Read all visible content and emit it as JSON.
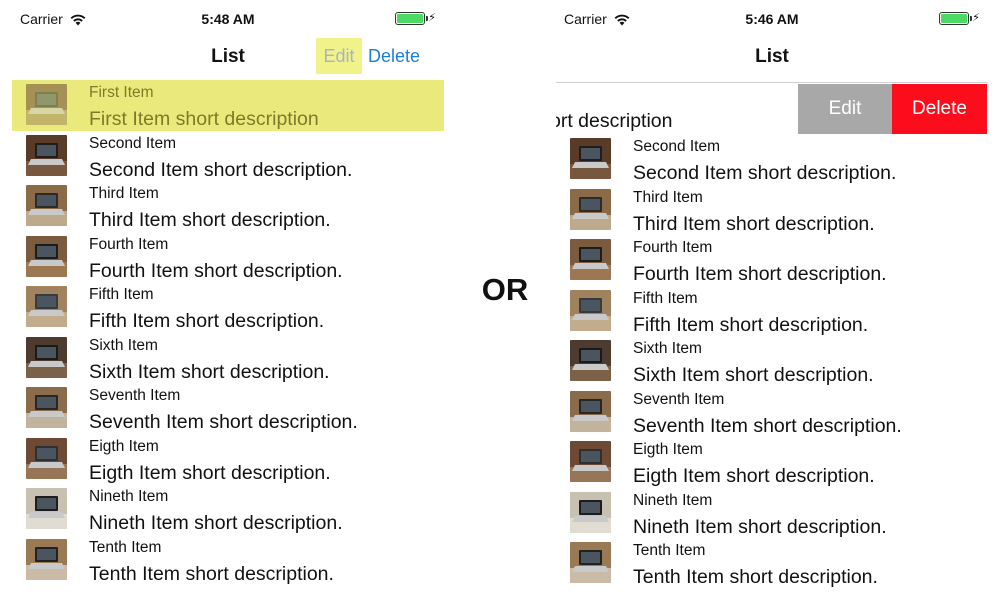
{
  "or_label": "OR",
  "colors": {
    "edit_highlight": "#f2f28a",
    "selected_row": "#eaea7c",
    "nav_link": "#1a7fd8",
    "swipe_edit_bg": "#a8a8a8",
    "swipe_delete_bg": "#fb0d1b",
    "battery": "#4cd964"
  },
  "left": {
    "status": {
      "carrier": "Carrier",
      "time": "5:48 AM"
    },
    "nav": {
      "title": "List",
      "edit": "Edit",
      "delete": "Delete"
    },
    "items": [
      {
        "title": "First Item",
        "desc": "First Item short description",
        "icon": "laptop-photo-icon"
      },
      {
        "title": "Second Item",
        "desc": "Second Item short description.",
        "icon": "laptop-photo-icon"
      },
      {
        "title": "Third Item",
        "desc": "Third Item short description.",
        "icon": "laptop-photo-icon"
      },
      {
        "title": "Fourth Item",
        "desc": "Fourth Item short description.",
        "icon": "laptop-photo-icon"
      },
      {
        "title": "Fifth Item",
        "desc": "Fifth Item short description.",
        "icon": "laptop-photo-icon"
      },
      {
        "title": "Sixth Item",
        "desc": "Sixth Item short description.",
        "icon": "laptop-photo-icon"
      },
      {
        "title": "Seventh Item",
        "desc": "Seventh Item short description.",
        "icon": "laptop-photo-icon"
      },
      {
        "title": "Eigth Item",
        "desc": "Eigth Item short description.",
        "icon": "laptop-photo-icon"
      },
      {
        "title": "Nineth Item",
        "desc": "Nineth Item short description.",
        "icon": "laptop-photo-icon"
      },
      {
        "title": "Tenth Item",
        "desc": "Tenth Item short description.",
        "icon": "laptop-photo-icon"
      }
    ]
  },
  "right": {
    "status": {
      "carrier": "Carrier",
      "time": "5:46 AM"
    },
    "nav": {
      "title": "List"
    },
    "swiped": {
      "visible_text": "ort description",
      "edit": "Edit",
      "delete": "Delete"
    },
    "items": [
      {
        "title": "Second Item",
        "desc": "Second Item short description.",
        "icon": "laptop-photo-icon"
      },
      {
        "title": "Third Item",
        "desc": "Third Item short description.",
        "icon": "laptop-photo-icon"
      },
      {
        "title": "Fourth Item",
        "desc": "Fourth Item short description.",
        "icon": "laptop-photo-icon"
      },
      {
        "title": "Fifth Item",
        "desc": "Fifth Item short description.",
        "icon": "laptop-photo-icon"
      },
      {
        "title": "Sixth Item",
        "desc": "Sixth Item short description.",
        "icon": "laptop-photo-icon"
      },
      {
        "title": "Seventh Item",
        "desc": "Seventh Item short description.",
        "icon": "laptop-photo-icon"
      },
      {
        "title": "Eigth Item",
        "desc": "Eigth Item short description.",
        "icon": "laptop-photo-icon"
      },
      {
        "title": "Nineth Item",
        "desc": "Nineth Item short description.",
        "icon": "laptop-photo-icon"
      },
      {
        "title": "Tenth Item",
        "desc": "Tenth Item short description.",
        "icon": "laptop-photo-icon"
      }
    ]
  }
}
